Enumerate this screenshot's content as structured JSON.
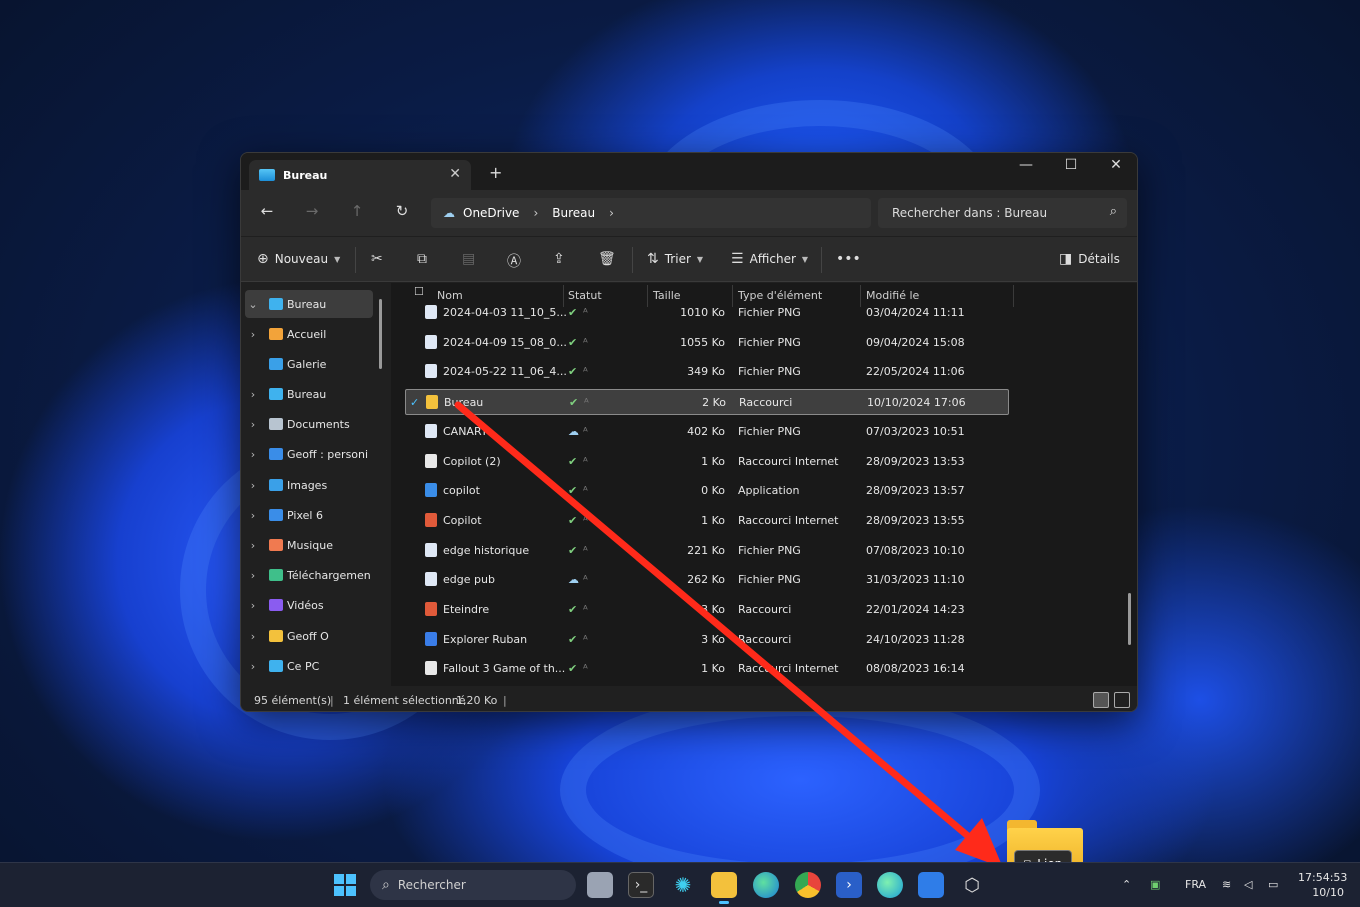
{
  "window": {
    "tab_title": "Bureau",
    "address": [
      "OneDrive",
      "Bureau"
    ],
    "search_placeholder": "Rechercher dans : Bureau"
  },
  "toolbar": {
    "new_label": "Nouveau",
    "sort_label": "Trier",
    "view_label": "Afficher",
    "details_label": "Détails"
  },
  "sidebar": {
    "items": [
      {
        "label": "Bureau",
        "icon": "desktop-icon",
        "color": "#3fb2ee"
      },
      {
        "label": "Accueil",
        "icon": "home-icon",
        "color": "#f2a33a"
      },
      {
        "label": "Galerie",
        "icon": "gallery-icon",
        "color": "#3aa0e8"
      },
      {
        "label": "Bureau",
        "icon": "desktop-icon",
        "color": "#3fb2ee"
      },
      {
        "label": "Documents",
        "icon": "documents-icon",
        "color": "#b8c4d0"
      },
      {
        "label": "Geoff : personi",
        "icon": "cloud-icon",
        "color": "#3a8de8"
      },
      {
        "label": "Images",
        "icon": "images-icon",
        "color": "#3aa0e8"
      },
      {
        "label": "Pixel 6",
        "icon": "phone-icon",
        "color": "#3a8de8"
      },
      {
        "label": "Musique",
        "icon": "music-icon",
        "color": "#f07a50"
      },
      {
        "label": "Téléchargemen",
        "icon": "download-icon",
        "color": "#3fbf8a"
      },
      {
        "label": "Vidéos",
        "icon": "video-icon",
        "color": "#8a5cf0"
      },
      {
        "label": "Geoff O",
        "icon": "folder-icon",
        "color": "#f3c13c"
      },
      {
        "label": "Ce PC",
        "icon": "pc-icon",
        "color": "#3fb2ee"
      }
    ]
  },
  "columns": {
    "name": "Nom",
    "status": "Statut",
    "size": "Taille",
    "type": "Type d'élément",
    "modified": "Modifié le"
  },
  "files": [
    {
      "name": "2024-04-03 11_10_5...",
      "status": "✔",
      "size": "1010 Ko",
      "type": "Fichier PNG",
      "modified": "03/04/2024 11:11",
      "color": "#dfe8f5"
    },
    {
      "name": "2024-04-09 15_08_0...",
      "status": "✔",
      "size": "1055 Ko",
      "type": "Fichier PNG",
      "modified": "09/04/2024 15:08",
      "color": "#dfe8f5"
    },
    {
      "name": "2024-05-22 11_06_4...",
      "status": "✔",
      "size": "349 Ko",
      "type": "Fichier PNG",
      "modified": "22/05/2024 11:06",
      "color": "#dfe8f5"
    },
    {
      "name": "Bureau",
      "status": "✔",
      "size": "2 Ko",
      "type": "Raccourci",
      "modified": "10/10/2024 17:06",
      "color": "#f3c13c"
    },
    {
      "name": "CANARY",
      "status": "☁",
      "size": "402 Ko",
      "type": "Fichier PNG",
      "modified": "07/03/2023 10:51",
      "color": "#dfe8f5"
    },
    {
      "name": "Copilot (2)",
      "status": "✔",
      "size": "1 Ko",
      "type": "Raccourci Internet",
      "modified": "28/09/2023 13:53",
      "color": "#e8e8e8"
    },
    {
      "name": "copilot",
      "status": "✔",
      "size": "0 Ko",
      "type": "Application",
      "modified": "28/09/2023 13:57",
      "color": "#3a8de8"
    },
    {
      "name": "Copilot",
      "status": "✔",
      "size": "1 Ko",
      "type": "Raccourci Internet",
      "modified": "28/09/2023 13:55",
      "color": "#e05a3a"
    },
    {
      "name": "edge historique",
      "status": "✔",
      "size": "221 Ko",
      "type": "Fichier PNG",
      "modified": "07/08/2023 10:10",
      "color": "#dfe8f5"
    },
    {
      "name": "edge pub",
      "status": "☁",
      "size": "262 Ko",
      "type": "Fichier PNG",
      "modified": "31/03/2023 11:10",
      "color": "#dfe8f5"
    },
    {
      "name": "Eteindre",
      "status": "✔",
      "size": "3 Ko",
      "type": "Raccourci",
      "modified": "22/01/2024 14:23",
      "color": "#e05a3a"
    },
    {
      "name": "Explorer Ruban",
      "status": "✔",
      "size": "3 Ko",
      "type": "Raccourci",
      "modified": "24/10/2023 11:28",
      "color": "#3a7de8"
    },
    {
      "name": "Fallout 3 Game of th...",
      "status": "✔",
      "size": "1 Ko",
      "type": "Raccourci Internet",
      "modified": "08/08/2023 16:14",
      "color": "#e8e8e8"
    }
  ],
  "statusbar": {
    "count": "95 élément(s)",
    "selection": "1 élément sélectionné",
    "selection_size": "1,20 Ko"
  },
  "drag": {
    "label": "Lien"
  },
  "taskbar": {
    "search_label": "Rechercher",
    "lang": "FRA",
    "time": "17:54:53",
    "date": "10/10"
  },
  "colors": {
    "accent": "#4cc2ff",
    "arrow": "#ff2a1a"
  }
}
